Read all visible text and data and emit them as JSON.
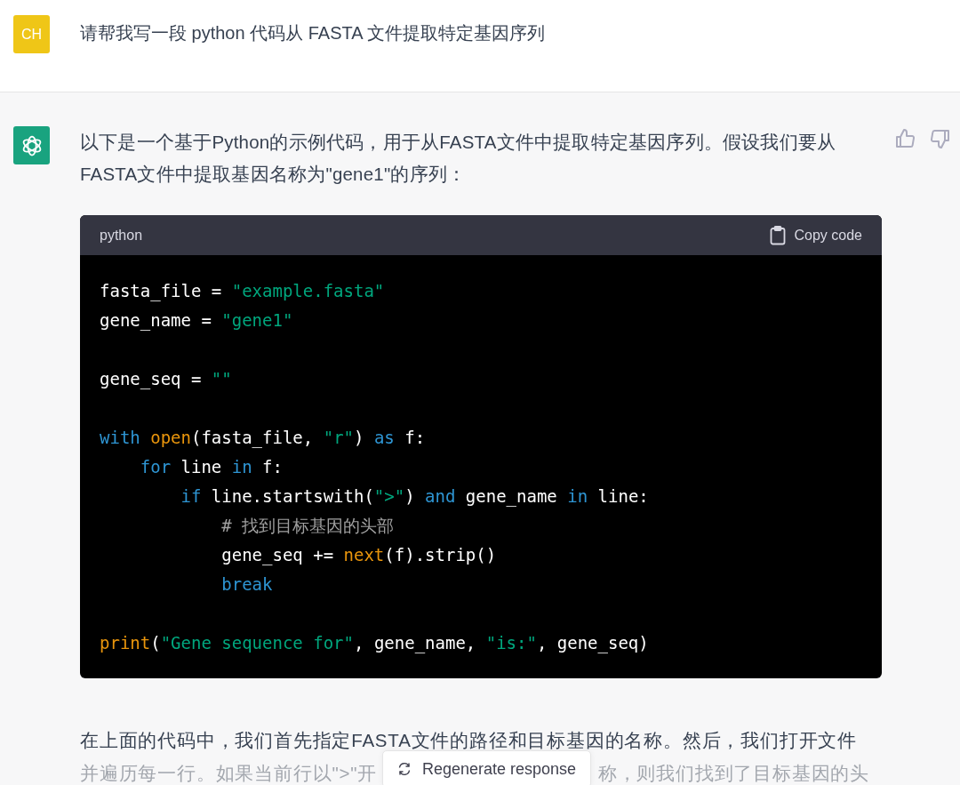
{
  "user_message": {
    "avatar": "CH",
    "text": "请帮我写一段 python 代码从 FASTA 文件提取特定基因序列"
  },
  "assistant_message": {
    "intro": "以下是一个基于Python的示例代码，用于从FASTA文件中提取特定基因序列。假设我们要从FASTA文件中提取基因名称为\"gene1\"的序列：",
    "code_block": {
      "language": "python",
      "copy_label": "Copy code",
      "lines": [
        {
          "kind": "code",
          "tokens": [
            {
              "kind": "plain",
              "text": "fasta_file = "
            },
            {
              "kind": "string",
              "text": "\"example.fasta\""
            }
          ]
        },
        {
          "kind": "code",
          "tokens": [
            {
              "kind": "plain",
              "text": "gene_name = "
            },
            {
              "kind": "string",
              "text": "\"gene1\""
            }
          ]
        },
        {
          "kind": "blank"
        },
        {
          "kind": "code",
          "tokens": [
            {
              "kind": "plain",
              "text": "gene_seq = "
            },
            {
              "kind": "string",
              "text": "\"\""
            }
          ]
        },
        {
          "kind": "blank"
        },
        {
          "kind": "code",
          "tokens": [
            {
              "kind": "keyword",
              "text": "with "
            },
            {
              "kind": "builtin",
              "text": "open"
            },
            {
              "kind": "plain",
              "text": "(fasta_file, "
            },
            {
              "kind": "string",
              "text": "\"r\""
            },
            {
              "kind": "plain",
              "text": ") "
            },
            {
              "kind": "keyword",
              "text": "as"
            },
            {
              "kind": "plain",
              "text": " f:"
            }
          ]
        },
        {
          "kind": "code",
          "tokens": [
            {
              "kind": "keyword",
              "text": "    for"
            },
            {
              "kind": "plain",
              "text": " line "
            },
            {
              "kind": "keyword",
              "text": "in"
            },
            {
              "kind": "plain",
              "text": " f:"
            }
          ]
        },
        {
          "kind": "code",
          "tokens": [
            {
              "kind": "keyword",
              "text": "        if"
            },
            {
              "kind": "plain",
              "text": " line.startswith("
            },
            {
              "kind": "string",
              "text": "\">\""
            },
            {
              "kind": "plain",
              "text": ") "
            },
            {
              "kind": "keyword",
              "text": "and"
            },
            {
              "kind": "plain",
              "text": " gene_name "
            },
            {
              "kind": "keyword",
              "text": "in"
            },
            {
              "kind": "plain",
              "text": " line:"
            }
          ]
        },
        {
          "kind": "code",
          "tokens": [
            {
              "kind": "comment",
              "text": "            # 找到目标基因的头部"
            }
          ]
        },
        {
          "kind": "code",
          "tokens": [
            {
              "kind": "plain",
              "text": "            gene_seq += "
            },
            {
              "kind": "builtin",
              "text": "next"
            },
            {
              "kind": "plain",
              "text": "(f).strip()"
            }
          ]
        },
        {
          "kind": "code",
          "tokens": [
            {
              "kind": "keyword",
              "text": "            break"
            }
          ]
        },
        {
          "kind": "blank"
        },
        {
          "kind": "code",
          "tokens": [
            {
              "kind": "builtin",
              "text": "print"
            },
            {
              "kind": "plain",
              "text": "("
            },
            {
              "kind": "string",
              "text": "\"Gene sequence for\""
            },
            {
              "kind": "plain",
              "text": ", gene_name, "
            },
            {
              "kind": "string",
              "text": "\"is:\""
            },
            {
              "kind": "plain",
              "text": ", gene_seq)"
            }
          ]
        }
      ]
    },
    "explanation_line": "在上面的代码中，我们首先指定FASTA文件的路径和目标基因的名称。然后，我们打开文件",
    "faded_line_parts": [
      "并遍历每一行。如果当前行以\">\"开",
      "称，则我们找到了目标基因的头"
    ]
  },
  "regenerate_button": "Regenerate response"
}
